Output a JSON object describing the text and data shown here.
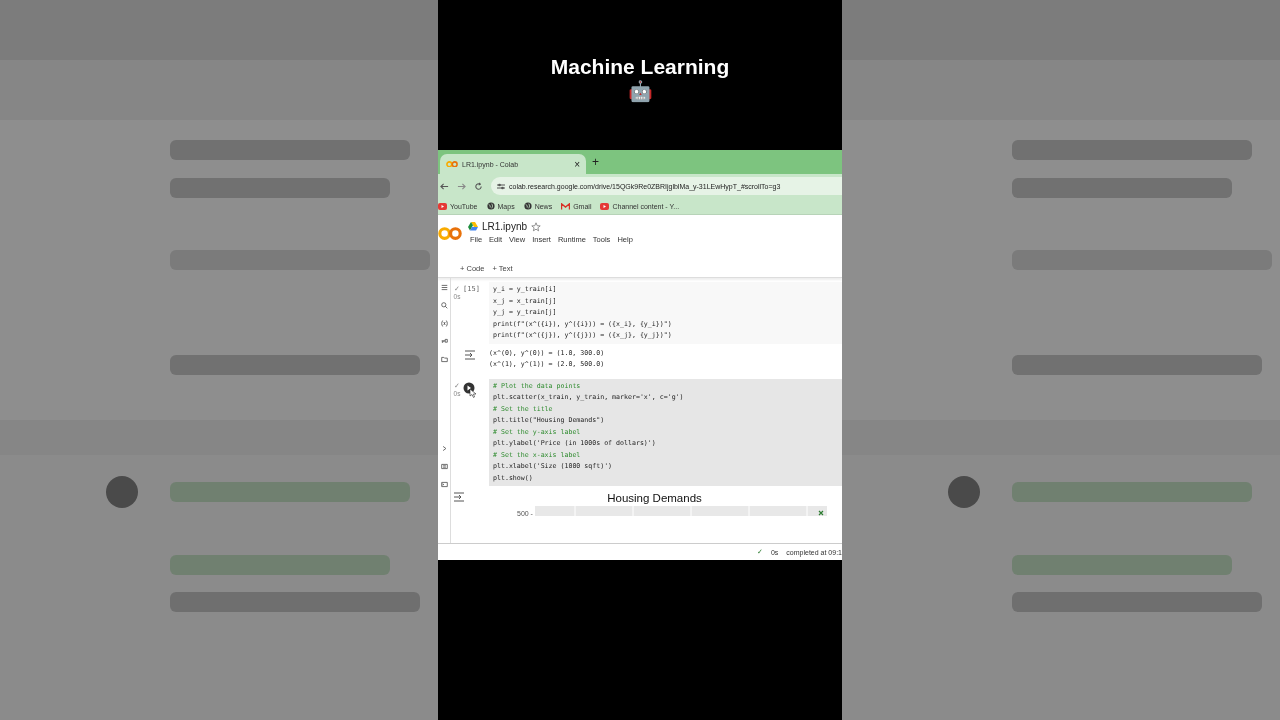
{
  "page_title": "Machine Learning",
  "title_emoji": "🤖",
  "browser": {
    "tab": {
      "title": "LR1.ipynb - Colab",
      "close": "×"
    },
    "new_tab": "+",
    "url": "colab.research.google.com/drive/15QGk9Re0ZBRIjglblMa_y-31LEwHypT_#scrollTo=g3",
    "bookmarks": [
      {
        "label": "YouTube",
        "kind": "video"
      },
      {
        "label": "Maps",
        "kind": "globe"
      },
      {
        "label": "News",
        "kind": "globe"
      },
      {
        "label": "Gmail",
        "kind": "mail"
      },
      {
        "label": "Channel content - Y...",
        "kind": "video"
      }
    ]
  },
  "notebook": {
    "file_name": "LR1.ipynb",
    "menu": [
      "File",
      "Edit",
      "View",
      "Insert",
      "Runtime",
      "Tools",
      "Help"
    ],
    "toolbar": [
      "+ Code",
      "+ Text"
    ],
    "cells": [
      {
        "exec_count": "[15]",
        "check": "✓",
        "status": "0s",
        "running": false,
        "lines": [
          {
            "kind": "code",
            "text": "y_i = y_train[i]"
          },
          {
            "kind": "code",
            "text": "x_j = x_train[j]"
          },
          {
            "kind": "code",
            "text": "y_j = y_train[j]"
          },
          {
            "kind": "code",
            "text": "print(f\"(x^({i}), y^({i})) = ({x_i}, {y_i})\")"
          },
          {
            "kind": "code",
            "text": "print(f\"(x^({j}), y^({j})) = ({x_j}, {y_j})\")"
          }
        ],
        "output": [
          "(x^(0), y^(0)) = (1.0, 300.0)",
          "(x^(1), y^(1)) = (2.0, 500.0)"
        ]
      },
      {
        "check": "✓",
        "status": "0s",
        "running": true,
        "lines": [
          {
            "kind": "comment",
            "text": "# Plot the data points"
          },
          {
            "kind": "code",
            "text": "plt.scatter(x_train, y_train, marker='x', c='g')"
          },
          {
            "kind": "comment",
            "text": "# Set the title"
          },
          {
            "kind": "code",
            "text": "plt.title(\"Housing Demands\")"
          },
          {
            "kind": "comment",
            "text": "# Set the y-axis label"
          },
          {
            "kind": "code",
            "text": "plt.ylabel('Price (in 1000s of dollars)')"
          },
          {
            "kind": "comment",
            "text": "# Set the x-axis label"
          },
          {
            "kind": "code",
            "text": "plt.xlabel('Size (1000 sqft)')"
          },
          {
            "kind": "code",
            "text": "plt.show()"
          }
        ],
        "plot": {
          "title": "Housing Demands",
          "y_tick": "500 -"
        }
      }
    ]
  },
  "status_bar": {
    "check": "✓",
    "duration": "0s",
    "completed": "completed at 09:1"
  }
}
